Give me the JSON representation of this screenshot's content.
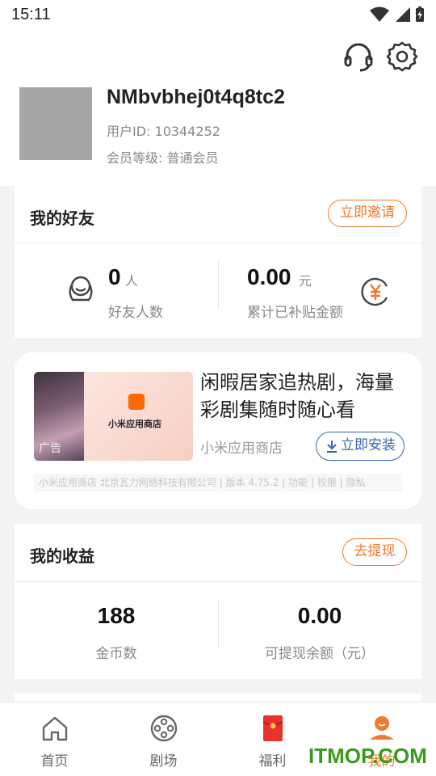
{
  "status_bar": {
    "time": "15:11"
  },
  "profile": {
    "username": "NMbvbhej0t4q8tc2",
    "user_id": "用户ID: 10344252",
    "member_level": "会员等级: 普通会员"
  },
  "friends_card": {
    "title": "我的好友",
    "invite_button": "立即邀请",
    "friend_count": "0",
    "friend_unit": "人",
    "friend_label": "好友人数",
    "subsidy_amount": "0.00",
    "subsidy_unit": "元",
    "subsidy_label": "累计已补贴金额"
  },
  "ad_card": {
    "image_store_name": "小米应用商店",
    "image_tag": "广告",
    "headline": "闲暇居家追热剧，海量彩剧集随时随心看",
    "source": "小米应用商店",
    "install_button": "立即安装",
    "footer": "小米应用商店 北京瓦力网络科技有限公司 | 版本 4.75.2 | 功能 | 权限 | 隐私"
  },
  "earnings_card": {
    "title": "我的收益",
    "withdraw_button": "去提现",
    "coins": "188",
    "coins_label": "金币数",
    "balance": "0.00",
    "balance_label": "可提现余额（元）"
  },
  "tabbar": {
    "tabs": [
      {
        "label": "首页",
        "icon": "home-icon"
      },
      {
        "label": "剧场",
        "icon": "film-reel-icon"
      },
      {
        "label": "福利",
        "icon": "red-envelope-icon"
      },
      {
        "label": "我的",
        "icon": "profile-icon"
      }
    ],
    "active_color": "#f07a2c"
  },
  "watermark": "ITMOP.COM",
  "colors": {
    "accent": "#f07a2c",
    "install_blue": "#3a66b0"
  }
}
